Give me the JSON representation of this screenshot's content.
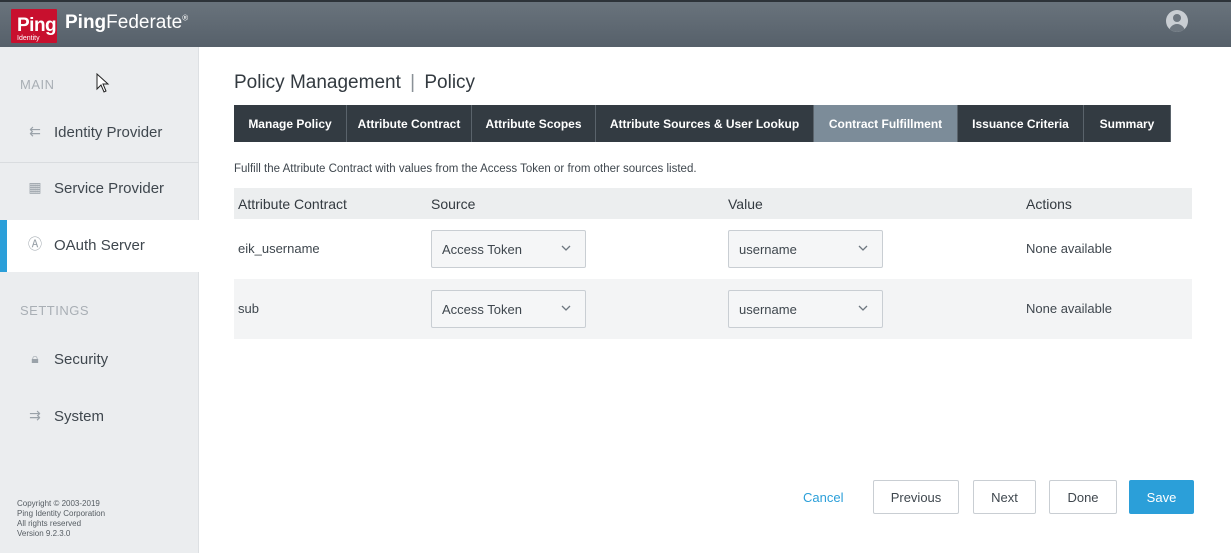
{
  "brand": {
    "logo_text": "Ping",
    "logo_subtext": "Identity",
    "product_bold": "Ping",
    "product_rest": "Federate",
    "product_mark": "®",
    "accent_color": "#2b9fd9",
    "logo_color": "#c8102e"
  },
  "sidebar": {
    "section_main": "MAIN",
    "section_settings": "SETTINGS",
    "items": [
      {
        "label": "Identity Provider",
        "icon": "identity-provider-icon",
        "glyph": "⇇"
      },
      {
        "label": "Service Provider",
        "icon": "service-provider-icon",
        "glyph": "▦"
      },
      {
        "label": "OAuth Server",
        "icon": "oauth-icon",
        "glyph": "Ⓐ"
      },
      {
        "label": "Security",
        "icon": "lock-icon",
        "glyph": "🔒︎"
      },
      {
        "label": "System",
        "icon": "sliders-icon",
        "glyph": "⇉"
      }
    ],
    "footer": {
      "line1": "Copyright © 2003-2019",
      "line2": "Ping Identity Corporation",
      "line3": "All rights reserved",
      "line4": "Version 9.2.3.0"
    }
  },
  "main": {
    "title_left": "Policy Management",
    "title_sep": "|",
    "title_right": "Policy",
    "tabs": [
      {
        "label": "Manage Policy"
      },
      {
        "label": "Attribute Contract"
      },
      {
        "label": "Attribute Scopes"
      },
      {
        "label": "Attribute Sources & User Lookup"
      },
      {
        "label": "Contract Fulfillment"
      },
      {
        "label": "Issuance Criteria"
      },
      {
        "label": "Summary"
      }
    ],
    "hint": "Fulfill the Attribute Contract with values from the Access Token or from other sources listed.",
    "table": {
      "headers": [
        "Attribute Contract",
        "Source",
        "Value",
        "Actions"
      ],
      "rows": [
        {
          "attribute": "eik_username",
          "source": "Access Token",
          "value": "username",
          "actions": "None available"
        },
        {
          "attribute": "sub",
          "source": "Access Token",
          "value": "username",
          "actions": "None available"
        }
      ]
    },
    "buttons": {
      "cancel": "Cancel",
      "previous": "Previous",
      "next": "Next",
      "done": "Done",
      "save": "Save"
    }
  }
}
